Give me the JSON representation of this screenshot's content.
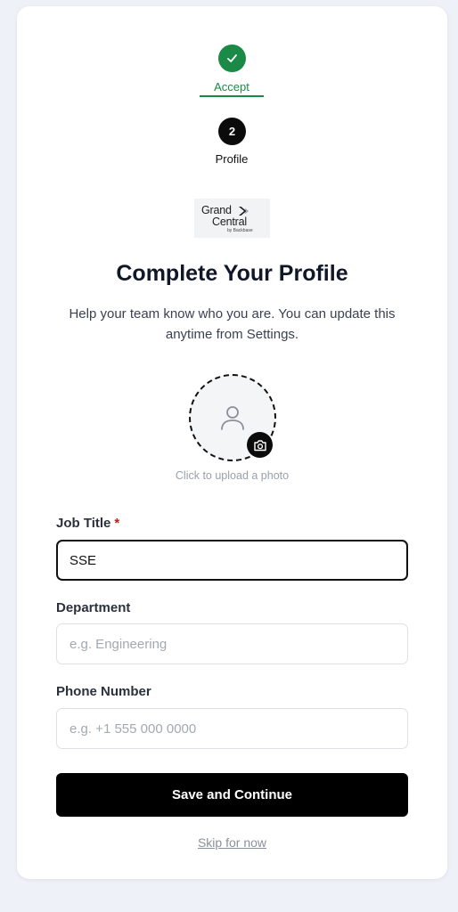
{
  "stepper": {
    "steps": [
      {
        "label": "Accept",
        "state": "done",
        "icon": "check-icon"
      },
      {
        "label": "Profile",
        "number": "2",
        "state": "current"
      }
    ]
  },
  "logo": {
    "line1": "Grand",
    "line2": "Central",
    "line3": "by Backbase"
  },
  "header": {
    "title": "Complete Your Profile",
    "subtitle": "Help your team know who you are. You can update this anytime from Settings."
  },
  "avatar": {
    "icon": "user-icon",
    "camera_icon": "camera-icon",
    "hint": "Click to upload a photo"
  },
  "form": {
    "job_title": {
      "label": "Job Title",
      "required_mark": "*",
      "value": "SSE",
      "placeholder": ""
    },
    "department": {
      "label": "Department",
      "value": "",
      "placeholder": "e.g. Engineering"
    },
    "phone": {
      "label": "Phone Number",
      "value": "",
      "placeholder": "e.g. +1 555 000 0000"
    }
  },
  "actions": {
    "primary_label": "Save and Continue",
    "skip_label": "Skip for now"
  },
  "colors": {
    "accent_green": "#1a8a46",
    "primary_black": "#000000",
    "required_red": "#b42318",
    "page_bg": "#eef1f7"
  }
}
